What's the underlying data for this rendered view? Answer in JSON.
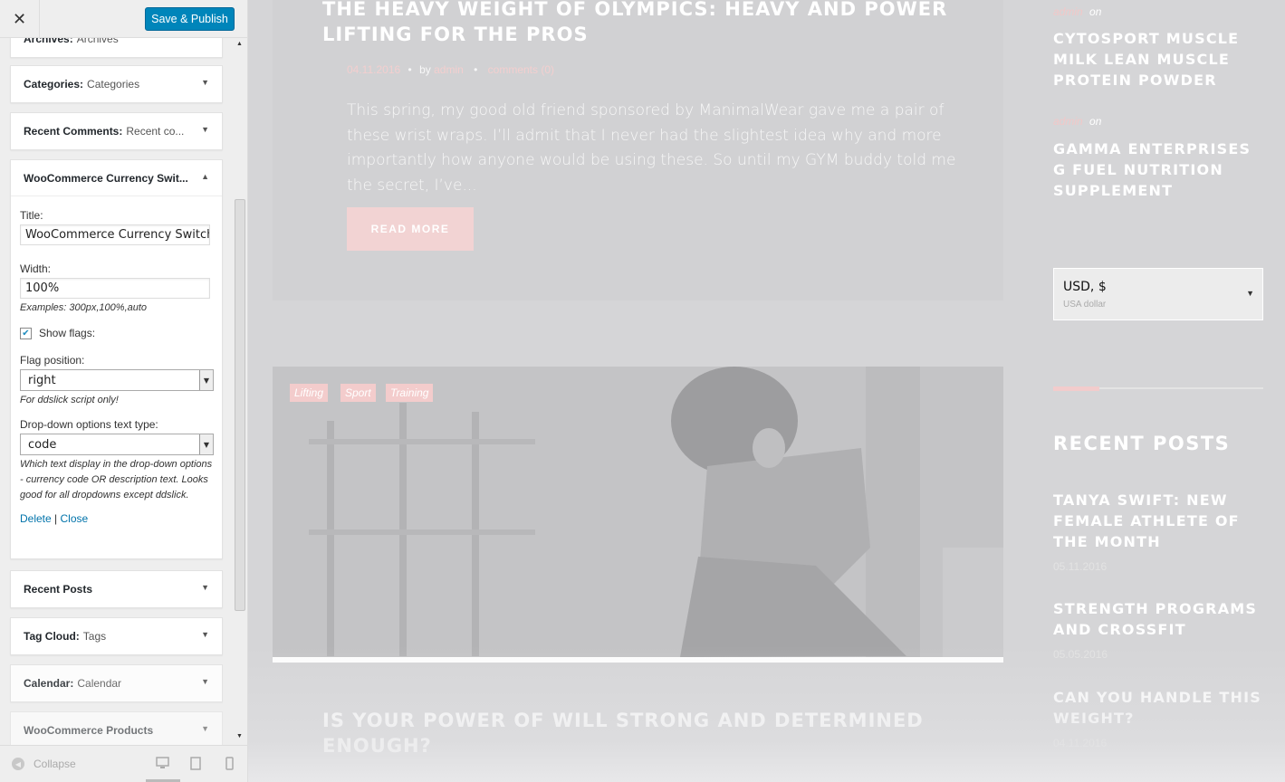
{
  "customizer": {
    "close_label": "✕",
    "save_label": "Save & Publish",
    "widgets_top": [
      {
        "name": "Archives:",
        "sub": "Archives"
      },
      {
        "name": "Categories:",
        "sub": "Categories"
      },
      {
        "name": "Recent Comments:",
        "sub": "Recent co..."
      }
    ],
    "open_widget": {
      "name": "WooCommerce Currency Swit...",
      "title_label": "Title:",
      "title_value": "WooCommerce Currency Switche",
      "width_label": "Width:",
      "width_value": "100%",
      "width_hint": "Examples: 300px,100%,auto",
      "show_flags_label": "Show flags:",
      "show_flags_checked": true,
      "flag_position_label": "Flag position:",
      "flag_position_value": "right",
      "flag_position_hint": "For ddslick script only!",
      "dropdown_text_label": "Drop-down options text type:",
      "dropdown_text_value": "code",
      "dropdown_text_hint": "Which text display in the drop-down options - currency code OR description text. Looks good for all dropdowns except ddslick.",
      "delete_label": "Delete",
      "separator": "|",
      "close_label": "Close"
    },
    "widgets_bottom": [
      {
        "name": "Recent Posts",
        "sub": ""
      },
      {
        "name": "Tag Cloud:",
        "sub": "Tags"
      },
      {
        "name": "Calendar:",
        "sub": "Calendar"
      },
      {
        "name": "WooCommerce Products",
        "sub": ""
      }
    ],
    "collapse_label": "Collapse"
  },
  "preview": {
    "post1": {
      "title": "THE HEAVY WEIGHT OF OLYMPICS: HEAVY AND POWER LIFTING FOR THE PROS",
      "date": "04.11.2016",
      "by": "by",
      "author": "admin",
      "comments": "comments (0)",
      "excerpt": "This spring, my good old friend sponsored by ManimalWear gave me a pair of these wrist wraps. I’ll admit that I never had the slightest idea why and more importantly how anyone would be using these. So until my GYM buddy told me the secret, I’ve...",
      "read_more": "READ MORE"
    },
    "tags": [
      "Lifting",
      "Sport",
      "Training"
    ],
    "post2_title": "IS YOUR POWER OF WILL STRONG AND DETERMINED ENOUGH?",
    "sidebar": {
      "products": [
        {
          "meta_author": "admin",
          "meta_on": "on",
          "title": "CYTOSPORT MUSCLE MILK LEAN MUSCLE PROTEIN POWDER"
        },
        {
          "meta_author": "admin",
          "meta_on": "on",
          "title": "GAMMA ENTERPRISES G FUEL NUTRITION SUPPLEMENT"
        }
      ],
      "currency": {
        "code": "USD, $",
        "desc": "USA dollar"
      },
      "recent_posts_heading": "RECENT POSTS",
      "recent_posts": [
        {
          "title": "TANYA SWIFT: NEW FEMALE ATHLETE OF THE MONTH",
          "date": "05.11.2016"
        },
        {
          "title": "STRENGTH PROGRAMS AND CROSSFIT",
          "date": "05.05.2016"
        },
        {
          "title": "CAN YOU HANDLE THIS WEIGHT?",
          "date": "04.11.2016"
        }
      ]
    }
  },
  "colors": {
    "accent_blue": "#0085ba",
    "link_blue": "#0073aa",
    "pink_accent": "#f2d3d3"
  }
}
